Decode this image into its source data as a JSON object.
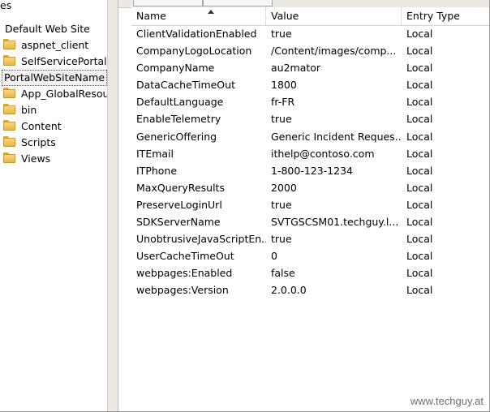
{
  "tree": {
    "fragment_label": "es",
    "site_label": "Default Web Site",
    "items_before": [
      {
        "label": "aspnet_client",
        "icon": "folder-icon"
      },
      {
        "label": "SelfServicePortal",
        "icon": "folder-icon"
      }
    ],
    "selected_label": "PortalWebSiteName",
    "items_after": [
      {
        "label": "App_GlobalResour",
        "icon": "folder-icon"
      },
      {
        "label": "bin",
        "icon": "folder-icon"
      },
      {
        "label": "Content",
        "icon": "folder-icon"
      },
      {
        "label": "Scripts",
        "icon": "folder-icon"
      },
      {
        "label": "Views",
        "icon": "folder-icon"
      }
    ]
  },
  "grid": {
    "columns": {
      "name": "Name",
      "value": "Value",
      "entry_type": "Entry Type"
    },
    "rows": [
      {
        "name": "ClientValidationEnabled",
        "value": "true",
        "entry_type": "Local"
      },
      {
        "name": "CompanyLogoLocation",
        "value": "/Content/images/comp...",
        "entry_type": "Local"
      },
      {
        "name": "CompanyName",
        "value": "au2mator",
        "entry_type": "Local"
      },
      {
        "name": "DataCacheTimeOut",
        "value": "1800",
        "entry_type": "Local"
      },
      {
        "name": "DefaultLanguage",
        "value": "fr-FR",
        "entry_type": "Local"
      },
      {
        "name": "EnableTelemetry",
        "value": "true",
        "entry_type": "Local"
      },
      {
        "name": "GenericOffering",
        "value": "Generic Incident Reques...",
        "entry_type": "Local"
      },
      {
        "name": "ITEmail",
        "value": "ithelp@contoso.com",
        "entry_type": "Local"
      },
      {
        "name": "ITPhone",
        "value": "1-800-123-1234",
        "entry_type": "Local"
      },
      {
        "name": "MaxQueryResults",
        "value": "2000",
        "entry_type": "Local"
      },
      {
        "name": "PreserveLoginUrl",
        "value": "true",
        "entry_type": "Local"
      },
      {
        "name": "SDKServerName",
        "value": "SVTGSCSM01.techguy.l...",
        "entry_type": "Local"
      },
      {
        "name": "UnobtrusiveJavaScriptEn...",
        "value": "true",
        "entry_type": "Local"
      },
      {
        "name": "UserCacheTimeOut",
        "value": "0",
        "entry_type": "Local"
      },
      {
        "name": "webpages:Enabled",
        "value": "false",
        "entry_type": "Local"
      },
      {
        "name": "webpages:Version",
        "value": "2.0.0.0",
        "entry_type": "Local"
      }
    ]
  },
  "watermark": "www.techguy.at",
  "colors": {
    "folder": "#e7b64b",
    "panel_bg": "#ece9e4"
  }
}
